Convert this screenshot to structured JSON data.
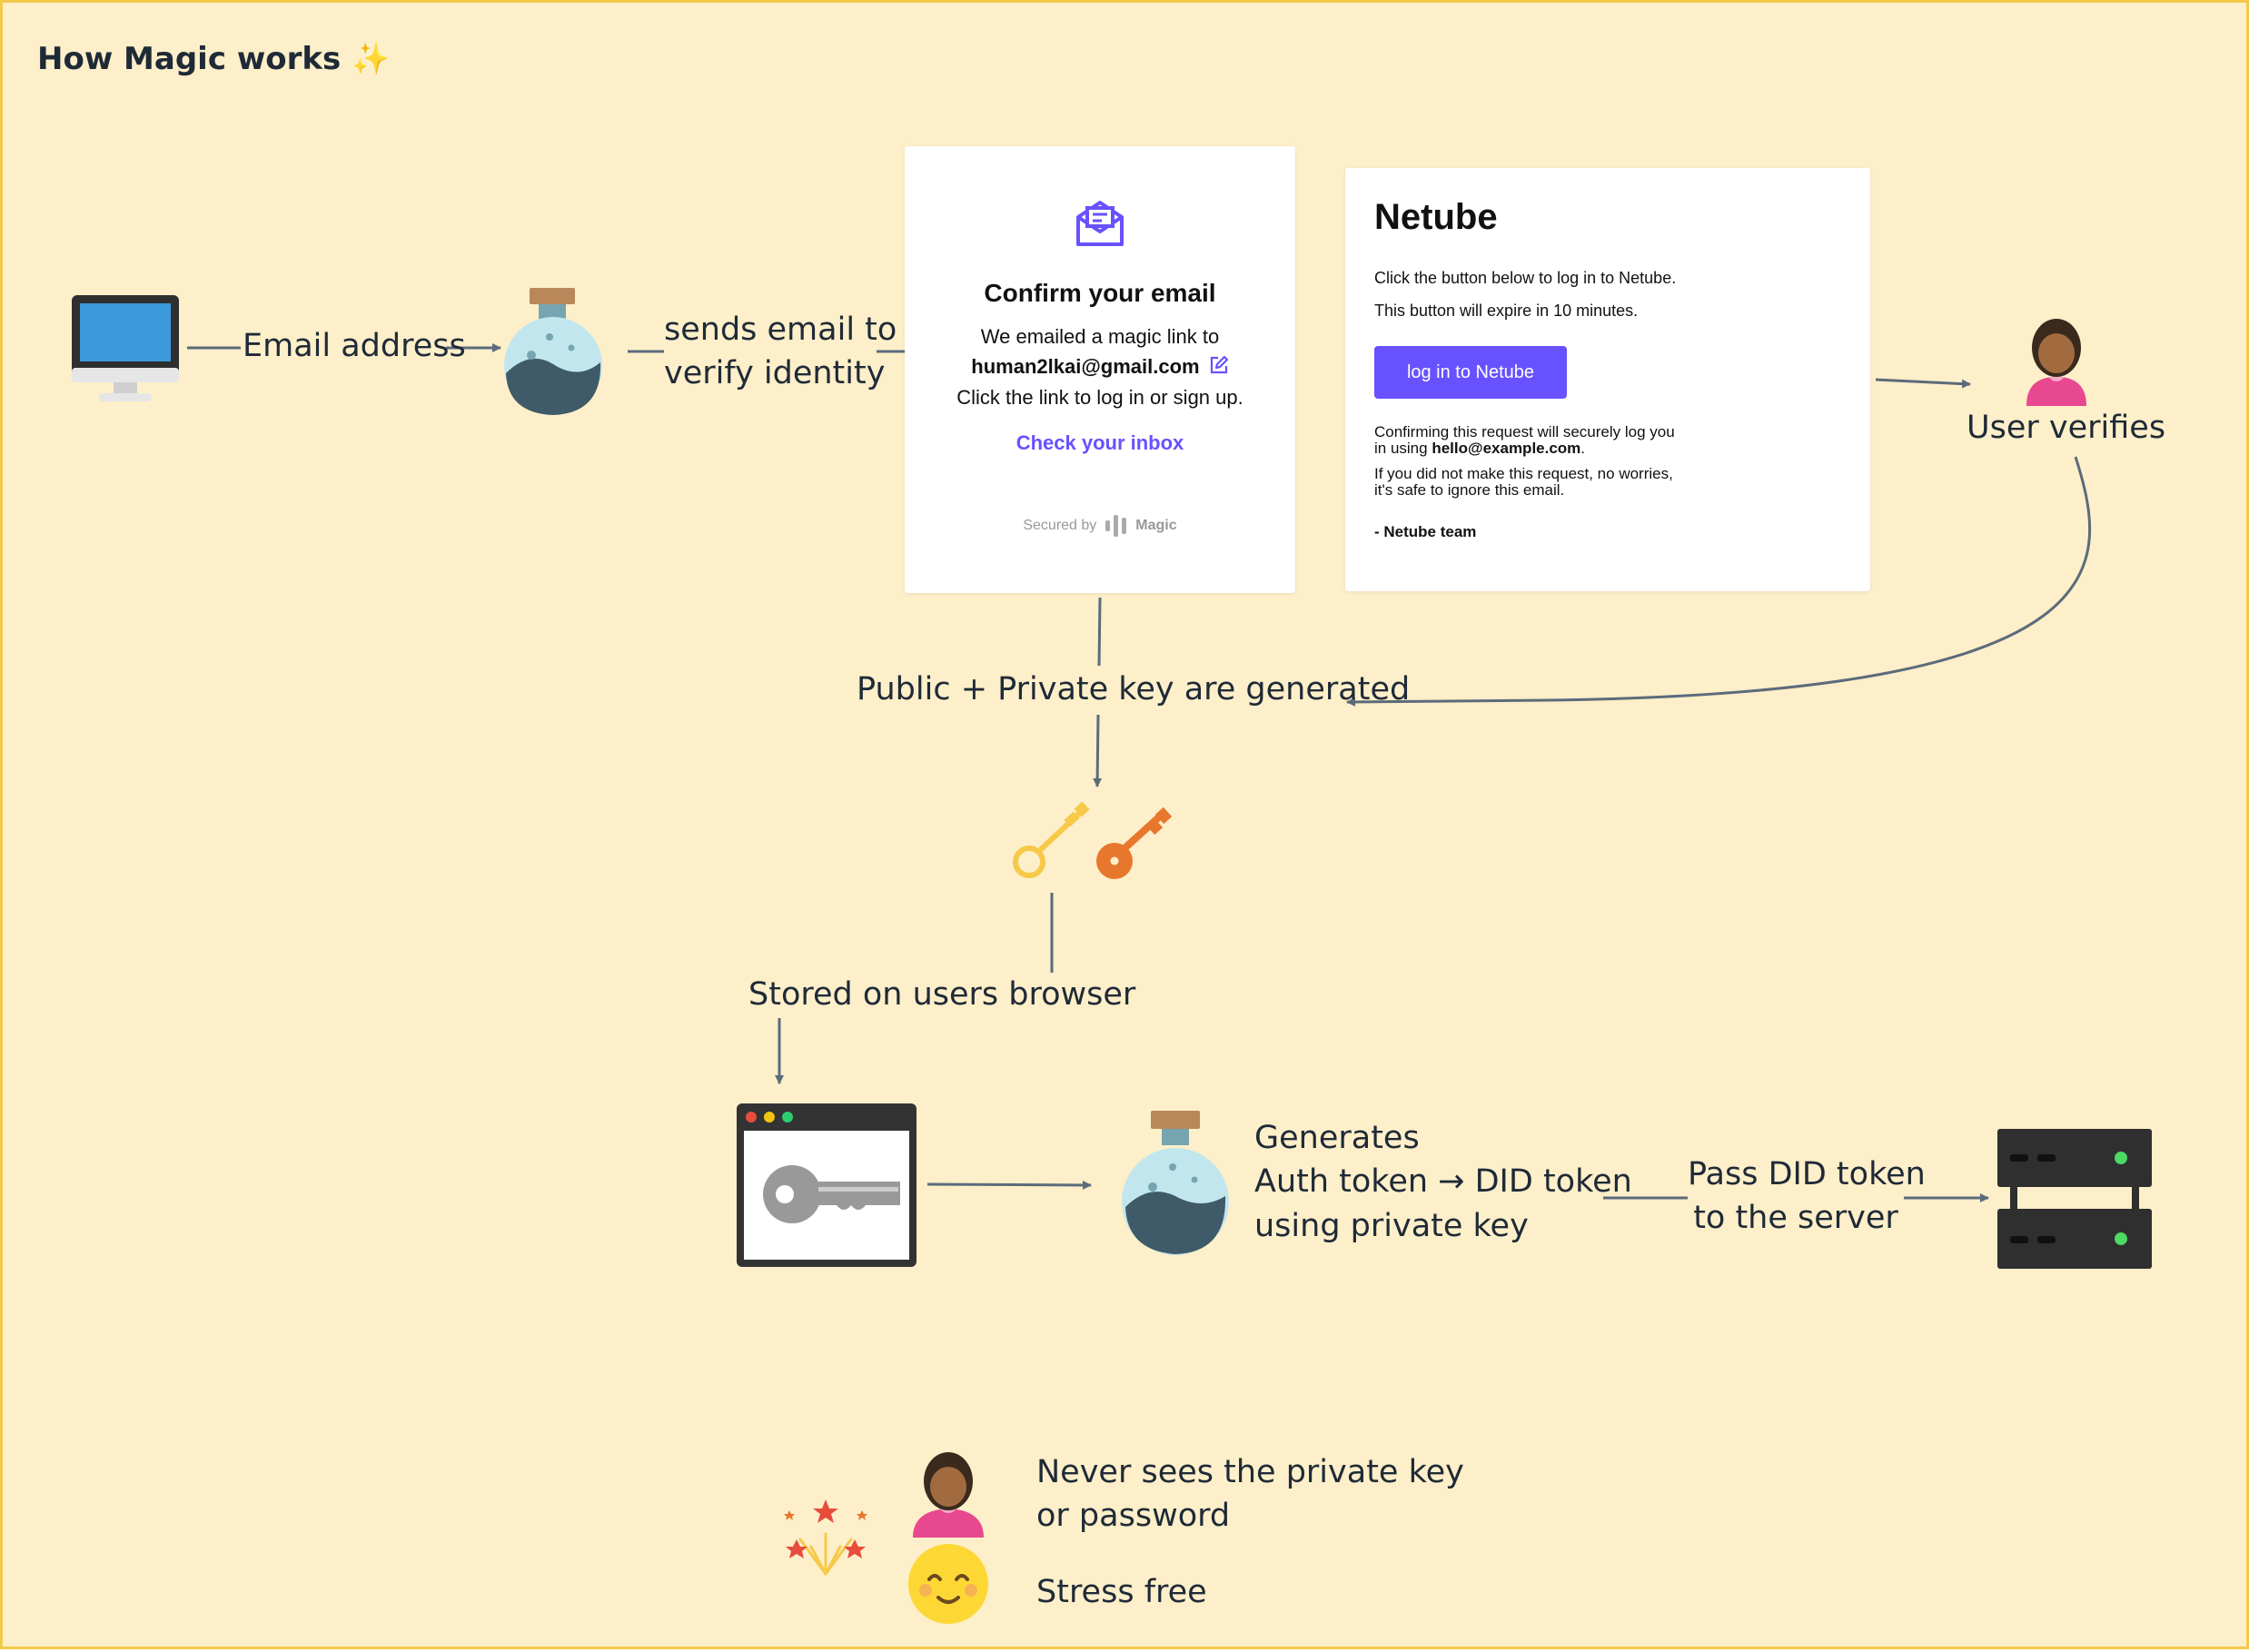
{
  "title": "How Magic works",
  "title_icon": "sparkles-icon",
  "labels": {
    "email_address": "Email address",
    "sends_email_1": "sends email to",
    "sends_email_2": "verify identity",
    "user_verifies": "User verifies",
    "keys_generated": "Public + Private key are generated",
    "stored_browser": "Stored on users browser",
    "generates_1": "Generates",
    "generates_2": "Auth token → DID token",
    "generates_3": "using private key",
    "pass_did_1": "Pass DID token",
    "pass_did_2": "to the server",
    "never_sees_1": "Never sees the private key",
    "never_sees_2": "or password",
    "stress_free": "Stress free"
  },
  "confirm_card": {
    "heading": "Confirm your email",
    "line1": "We emailed a magic link to",
    "email": "human2lkai@gmail.com",
    "line3": "Click the link to log in or sign up.",
    "link": "Check your inbox",
    "secured_by": "Secured by",
    "brand": "Magic"
  },
  "netube_card": {
    "brand": "Netube",
    "line1": "Click the button below to log in to Netube.",
    "line2": "This button will expire in 10 minutes.",
    "button": "log in to Netube",
    "confirm_a": "Confirming this request will securely log you",
    "confirm_b_prefix": "in using ",
    "confirm_b_email": "hello@example.com",
    "confirm_b_suffix": ".",
    "ignore_a": "If you did not make this request, no worries,",
    "ignore_b": "it's safe to ignore this email.",
    "signoff": "- Netube team"
  },
  "colors": {
    "background": "#fdefc9",
    "border": "#f2c94c",
    "arrow": "#5b6b7b",
    "accent": "#6851ff",
    "monitor_screen": "#3b9ad9",
    "flask_liquid": "#3f5a68",
    "flask_glass": "#c2e6ee",
    "key_yellow": "#f7c948",
    "key_orange": "#e8772e",
    "server": "#2f2f2f",
    "server_light": "#4cd964",
    "person_shirt": "#e8488f",
    "smiley": "#fdd835"
  }
}
